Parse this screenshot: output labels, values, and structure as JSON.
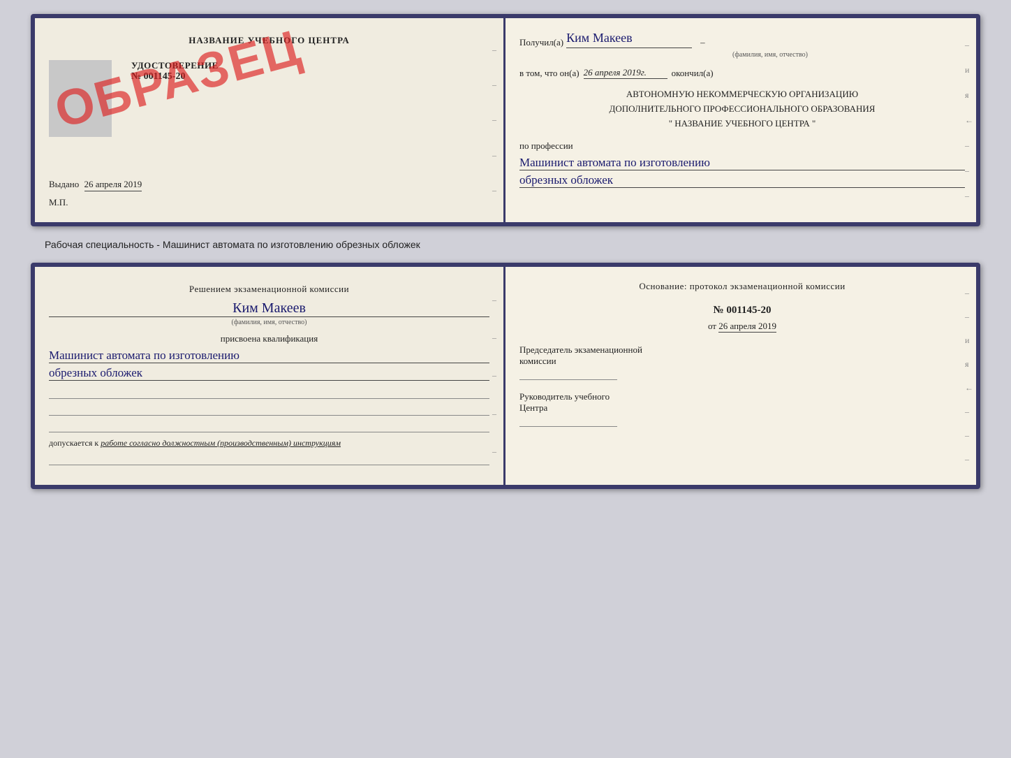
{
  "top_doc": {
    "left": {
      "title": "НАЗВАНИЕ УЧЕБНОГО ЦЕНТРА",
      "udostoverenie_label": "УДОСТОВЕРЕНИЕ",
      "number": "№ 001145-20",
      "vydano_label": "Выдано",
      "vydano_date": "26 апреля 2019",
      "mp": "М.П.",
      "obrazec": "ОБРАЗЕЦ"
    },
    "right": {
      "poluchil_label": "Получил(а)",
      "poluchil_name": "Ким Макеев",
      "fio_label": "(фамилия, имя, отчество)",
      "vtom_label": "в том, что он(а)",
      "vtom_date": "26 апреля 2019г.",
      "okonchil": "окончил(а)",
      "org_line1": "АВТОНОМНУЮ НЕКОММЕРЧЕСКУЮ ОРГАНИЗАЦИЮ",
      "org_line2": "ДОПОЛНИТЕЛЬНОГО ПРОФЕССИОНАЛЬНОГО ОБРАЗОВАНИЯ",
      "org_quote": "\"   НАЗВАНИЕ УЧЕБНОГО ЦЕНТРА   \"",
      "prof_label": "по профессии",
      "prof_name1": "Машинист автомата по изготовлению",
      "prof_name2": "обрезных обложек"
    }
  },
  "caption": "Рабочая специальность - Машинист автомата по изготовлению обрезных обложек",
  "bottom_doc": {
    "left": {
      "resheniye": "Решением экзаменационной комиссии",
      "kim_makeev": "Ким Макеев",
      "fio_label": "(фамилия, имя, отчество)",
      "prisvoena": "присвоена квалификация",
      "kval1": "Машинист автомата по изготовлению",
      "kval2": "обрезных обложек",
      "dopuskaetsya": "допускается к",
      "dopusk_text": "работе согласно должностным (производственным) инструкциям"
    },
    "right": {
      "osnovanie": "Основание: протокол экзаменационной комиссии",
      "number": "№ 001145-20",
      "ot_label": "от",
      "ot_date": "26 апреля 2019",
      "chairman_line1": "Председатель экзаменационной",
      "chairman_line2": "комиссии",
      "rukovoditel_line1": "Руководитель учебного",
      "rukovoditel_line2": "Центра"
    }
  }
}
